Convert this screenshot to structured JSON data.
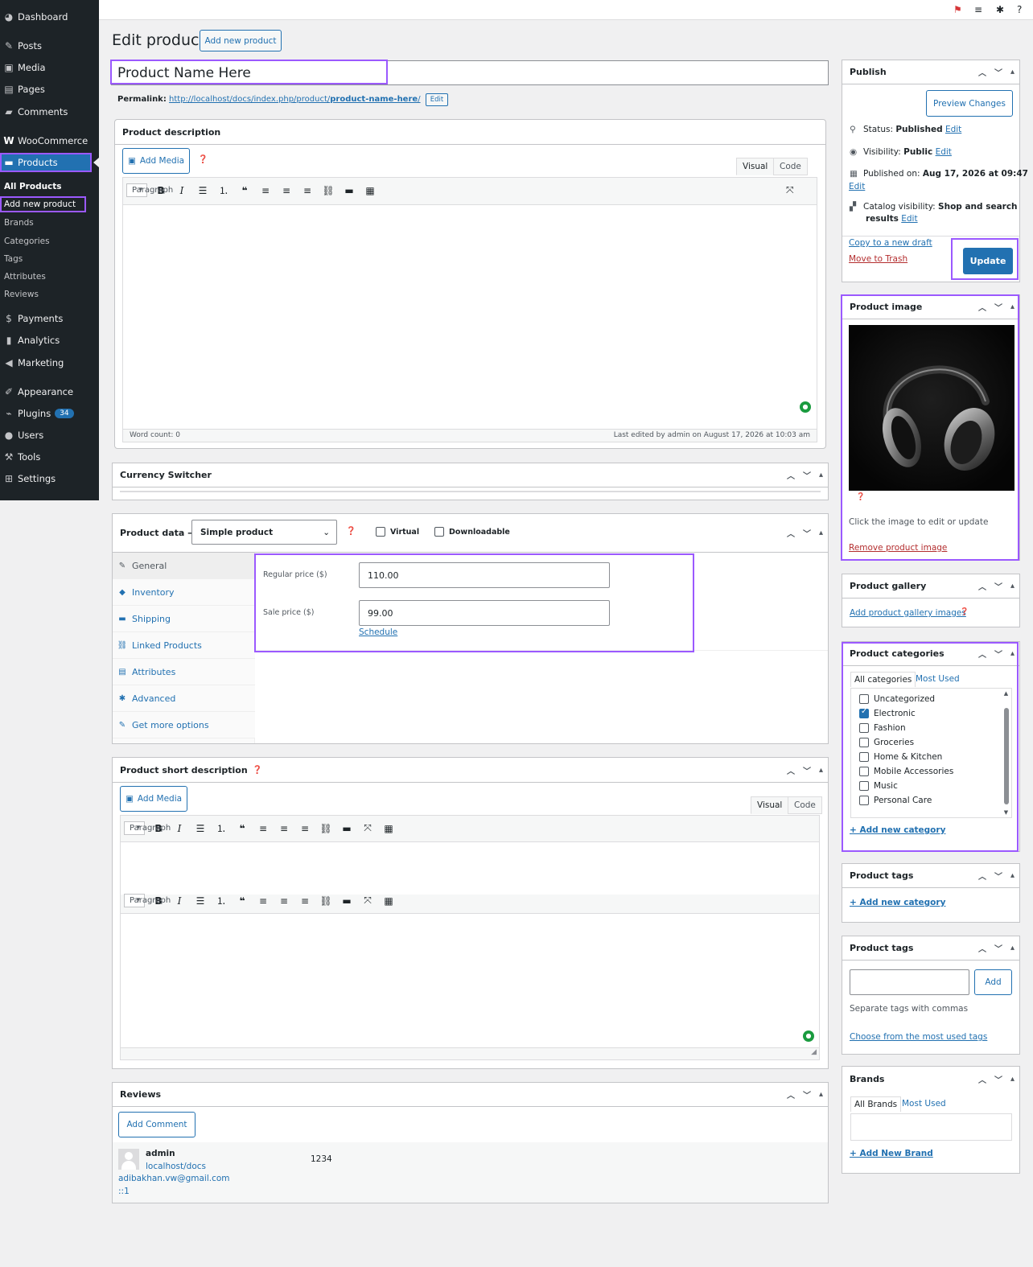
{
  "sidebar": {
    "items": [
      {
        "label": "Dashboard",
        "icon": "dashboard-icon"
      },
      {
        "label": "Posts",
        "icon": "pin-icon"
      },
      {
        "label": "Media",
        "icon": "media-icon"
      },
      {
        "label": "Pages",
        "icon": "page-icon"
      },
      {
        "label": "Comments",
        "icon": "comment-icon"
      },
      {
        "label": "WooCommerce",
        "icon": "woo-icon"
      },
      {
        "label": "Products",
        "icon": "archive-icon"
      },
      {
        "label": "Payments",
        "icon": "dollar-icon"
      },
      {
        "label": "Analytics",
        "icon": "chart-icon"
      },
      {
        "label": "Marketing",
        "icon": "megaphone-icon"
      },
      {
        "label": "Appearance",
        "icon": "brush-icon"
      },
      {
        "label": "Plugins",
        "icon": "plug-icon",
        "badge": "34"
      },
      {
        "label": "Users",
        "icon": "user-icon"
      },
      {
        "label": "Tools",
        "icon": "wrench-icon"
      },
      {
        "label": "Settings",
        "icon": "settings-icon"
      }
    ],
    "sub": [
      "All Products",
      "Add new product",
      "Brands",
      "Categories",
      "Tags",
      "Attributes",
      "Reviews"
    ]
  },
  "page": {
    "title": "Edit product",
    "add_new": "Add new product"
  },
  "product": {
    "name": "Product Name Here",
    "permalink_label": "Permalink:",
    "permalink_base": "http://localhost/docs/index.php/product/",
    "permalink_slug": "product-name-here",
    "permalink_end": "/",
    "permalink_edit": "Edit"
  },
  "description": {
    "heading": "Product description",
    "add_media": "Add Media",
    "tab_visual": "Visual",
    "tab_code": "Code",
    "format": "Paragraph",
    "word_count": "Word count: 0",
    "last_edited": "Last edited by admin on August 17, 2026 at 10:03 am"
  },
  "currency": {
    "heading": "Currency Switcher"
  },
  "product_data": {
    "heading": "Product data —",
    "type": "Simple product",
    "virtual": "Virtual",
    "downloadable": "Downloadable",
    "tabs": [
      "General",
      "Inventory",
      "Shipping",
      "Linked Products",
      "Attributes",
      "Advanced",
      "Get more options"
    ],
    "regular_label": "Regular price ($)",
    "regular_value": "110.00",
    "sale_label": "Sale price ($)",
    "sale_value": "99.00",
    "schedule": "Schedule"
  },
  "short_desc": {
    "heading": "Product short description",
    "add_media": "Add Media",
    "tab_visual": "Visual",
    "tab_code": "Code",
    "format": "Paragraph"
  },
  "reviews": {
    "heading": "Reviews",
    "add_comment": "Add Comment",
    "author": "admin",
    "site": "localhost/docs",
    "email": "adibakhan.vw@gmail.com",
    "ip": "::1",
    "content": "1234"
  },
  "publish": {
    "heading": "Publish",
    "preview": "Preview Changes",
    "status_label": "Status:",
    "status": "Published",
    "visibility_label": "Visibility:",
    "visibility": "Public",
    "published_label": "Published on:",
    "published": "Aug 17, 2026 at 09:47",
    "catalog_label": "Catalog visibility:",
    "catalog_1": "Shop and search",
    "catalog_2": "results",
    "edit": "Edit",
    "copy": "Copy to a new draft",
    "trash": "Move to Trash",
    "update": "Update"
  },
  "product_image": {
    "heading": "Product image",
    "hint": "Click the image to edit or update",
    "remove": "Remove product image"
  },
  "gallery": {
    "heading": "Product gallery",
    "add": "Add product gallery images"
  },
  "categories": {
    "heading": "Product categories",
    "tab_all": "All categories",
    "tab_most": "Most Used",
    "items": [
      {
        "name": "Uncategorized",
        "checked": false
      },
      {
        "name": "Electronic",
        "checked": true
      },
      {
        "name": "Fashion",
        "checked": false
      },
      {
        "name": "Groceries",
        "checked": false
      },
      {
        "name": "Home & Kitchen",
        "checked": false
      },
      {
        "name": "Mobile Accessories",
        "checked": false
      },
      {
        "name": "Music",
        "checked": false
      },
      {
        "name": "Personal Care",
        "checked": false
      }
    ],
    "add": "+ Add new category"
  },
  "tags_a": {
    "heading": "Product tags",
    "add": "+ Add new category"
  },
  "tags_b": {
    "heading": "Product tags",
    "add_btn": "Add",
    "hint": "Separate tags with commas",
    "choose": "Choose from the most used tags"
  },
  "brands": {
    "heading": "Brands",
    "tab_all": "All Brands",
    "tab_most": "Most Used",
    "add": "+ Add New Brand"
  },
  "colors": {
    "accent": "#2271b1",
    "highlight": "#9b59ff",
    "sidebar": "#1d2327"
  }
}
